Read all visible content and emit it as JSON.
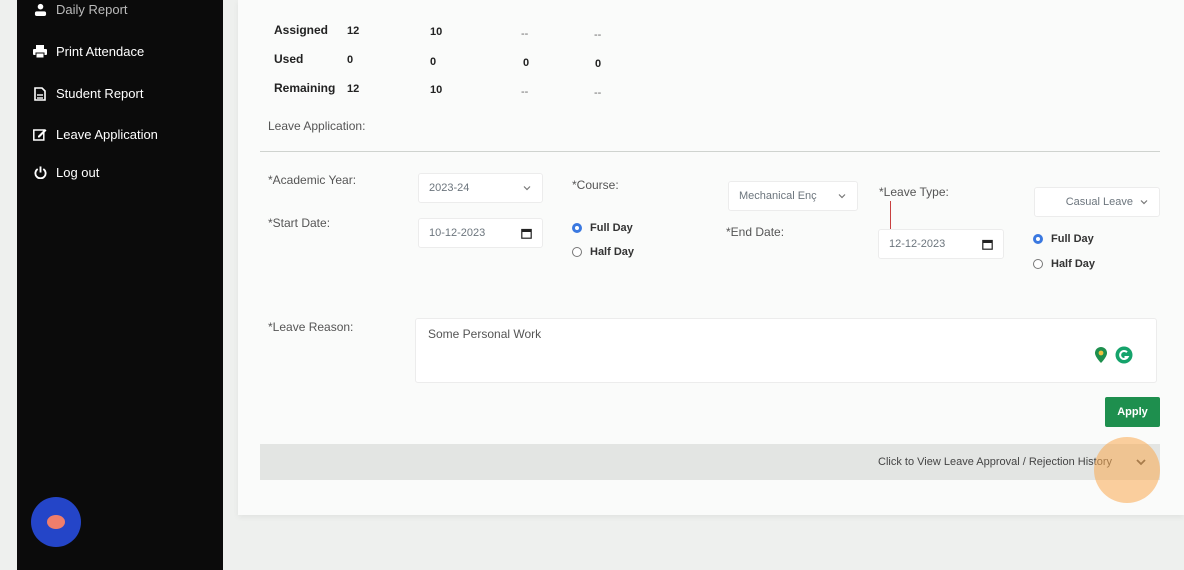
{
  "sidebar": {
    "items": [
      {
        "label": "Daily Report",
        "icon": "user-icon"
      },
      {
        "label": "Print Attendace",
        "icon": "printer-icon"
      },
      {
        "label": "Student Report",
        "icon": "document-icon"
      },
      {
        "label": "Leave Application",
        "icon": "edit-icon"
      },
      {
        "label": "Log out",
        "icon": "power-icon"
      }
    ]
  },
  "summary": {
    "rows": [
      {
        "label": "Assigned",
        "values": [
          "12",
          "10",
          "--",
          "--"
        ]
      },
      {
        "label": "Used",
        "values": [
          "0",
          "0",
          "0",
          "0"
        ]
      },
      {
        "label": "Remaining",
        "values": [
          "12",
          "10",
          "--",
          "--"
        ]
      }
    ]
  },
  "section_title": "Leave Application:",
  "form": {
    "academic_year_label": "*Academic Year:",
    "academic_year_value": "2023-24",
    "course_label": "*Course:",
    "course_value": "Mechanical Enç",
    "leave_type_label": "*Leave Type:",
    "leave_type_value": "Casual Leave",
    "start_date_label": "*Start Date:",
    "start_date_value": "10-12-2023",
    "end_date_label": "*End Date:",
    "end_date_value": "12-12-2023",
    "full_day_label": "Full Day",
    "half_day_label": "Half Day",
    "leave_reason_label": "*Leave Reason:",
    "leave_reason_value": "Some Personal Work"
  },
  "apply_label": "Apply",
  "history_label": "Click to View Leave Approval / Rejection History",
  "colors": {
    "accent_green": "#1e8f4e",
    "radio_blue": "#3a78e0",
    "sidebar_bg": "#0b0b0b"
  }
}
